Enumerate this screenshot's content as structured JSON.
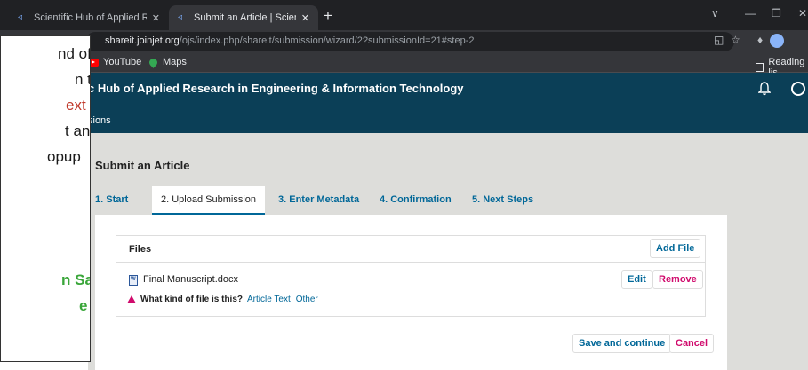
{
  "browser": {
    "tabs": [
      {
        "title": "Scientific Hub of Applied Researc",
        "active": false
      },
      {
        "title": "Submit an Article | Scientific Hub",
        "active": true
      }
    ],
    "new_tab_symbol": "+",
    "close_symbol": "✕",
    "url_host": "shareit.joinjet.org",
    "url_path": "/ojs/index.php/shareit/submission/wizard/2?submissionId=21#step-2",
    "bookmarks": [
      "YouTube",
      "Maps"
    ],
    "reading_list": "Reading list",
    "reading_list_visible": "Reading lis"
  },
  "site": {
    "title_visible": "c Hub of Applied Research in Engineering & Information Technology",
    "nav_visible": "sions"
  },
  "page": {
    "title": "Submit an Article",
    "wizard_tabs": [
      "1. Start",
      "2. Upload Submission",
      "3. Enter Metadata",
      "4. Confirmation",
      "5. Next Steps"
    ],
    "files": {
      "heading": "Files",
      "add_file": "Add File",
      "file_name": "Final Manuscript.docx",
      "edit": "Edit",
      "remove": "Remove",
      "question": "What kind of file is this?",
      "options": [
        "Article Text",
        "Other"
      ]
    },
    "save_continue": "Save and continue",
    "cancel": "Cancel"
  },
  "callout": {
    "lines": [
      "nd of",
      "n the",
      "ext /",
      "t any",
      "opup",
      "n Save",
      "e"
    ]
  },
  "colors": {
    "header_bg": "#0b3f57",
    "link": "#006798",
    "danger": "#d00a6c",
    "callout_red": "#c0392b",
    "callout_green": "#3aa63a"
  },
  "icons": [
    "puzzle-icon",
    "youtube-icon",
    "maps-icon",
    "bell-icon",
    "user-icon",
    "word-file-icon",
    "warning-icon"
  ]
}
